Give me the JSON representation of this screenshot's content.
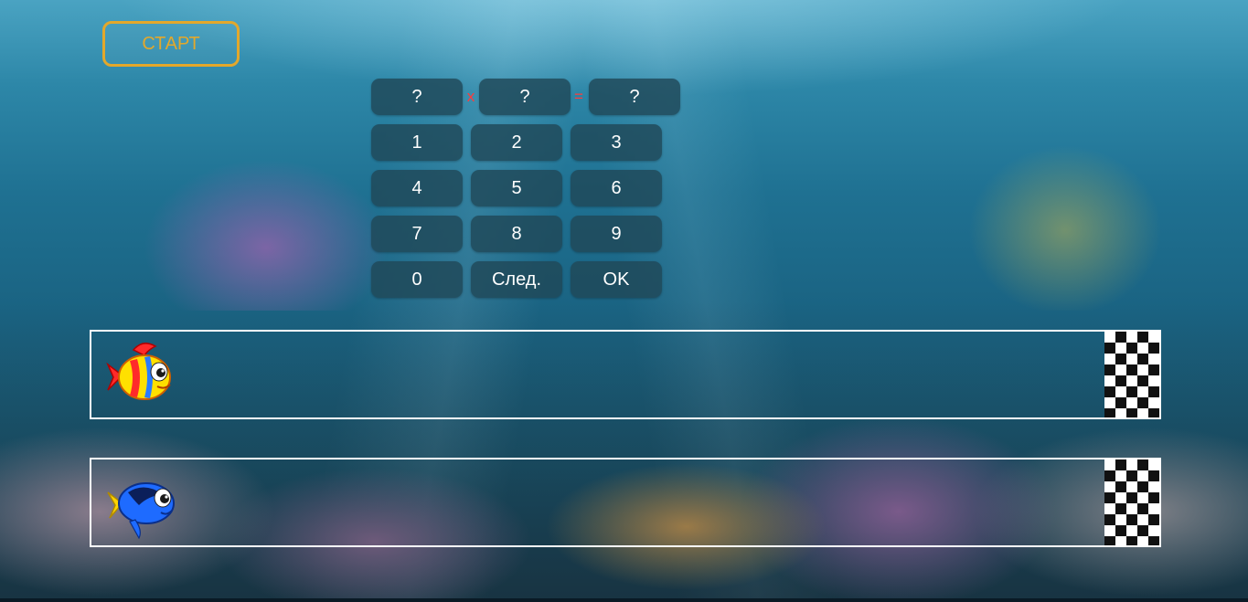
{
  "controls": {
    "start_label": "СТАРТ"
  },
  "equation": {
    "factor_a": "?",
    "times_sign": "x",
    "factor_b": "?",
    "equals_sign": "=",
    "result": "?"
  },
  "keypad": {
    "keys": [
      "1",
      "2",
      "3",
      "4",
      "5",
      "6",
      "7",
      "8",
      "9",
      "0",
      "След.",
      "OK"
    ]
  },
  "race": {
    "player_fish_icon": "red-yellow-fish-icon",
    "opponent_fish_icon": "blue-tang-fish-icon",
    "finish_icon": "checkered-flag-icon"
  },
  "colors": {
    "start_accent": "#e3a82b",
    "operator": "#ff3b3b",
    "key_background": "#204858",
    "lane_border": "#ffffff"
  }
}
